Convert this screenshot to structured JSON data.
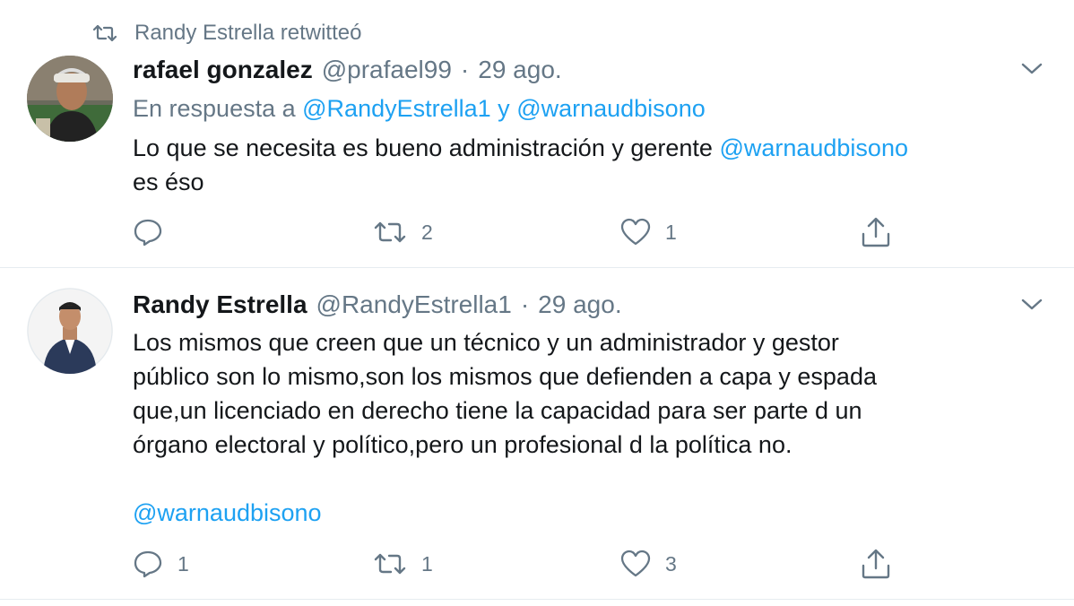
{
  "retweet_banner": {
    "icon": "retweet-icon",
    "text": "Randy Estrella retwitteó"
  },
  "tweets": [
    {
      "name": "rafael gonzalez",
      "handle": "@prafael99",
      "separator": "·",
      "date": "29 ago.",
      "reply_prefix": "En respuesta a",
      "reply_to_1": "@RandyEstrella1",
      "reply_conjunction": "y",
      "reply_to_2": "@warnaudbisono",
      "text_part1": "Lo que se necesita es bueno administración y gerente",
      "mention": "@warnaudbisono",
      "text_part2": "es éso",
      "counts": {
        "reply": "",
        "retweet": "2",
        "like": "1"
      }
    },
    {
      "name": "Randy Estrella",
      "handle": "@RandyEstrella1",
      "separator": "·",
      "date": "29 ago.",
      "text_lines": [
        "Los mismos que creen que un técnico y un administrador y gestor",
        "público son lo mismo,son los mismos que defienden a capa y espada",
        "que,un licenciado en derecho tiene la capacidad para ser parte d un",
        "órgano electoral y político,pero un profesional d la política no."
      ],
      "mention": "@warnaudbisono",
      "counts": {
        "reply": "1",
        "retweet": "1",
        "like": "3"
      }
    }
  ],
  "colors": {
    "link": "#1da1f2",
    "muted": "#657786",
    "text": "#14171a",
    "divider": "#e6ecf0"
  }
}
